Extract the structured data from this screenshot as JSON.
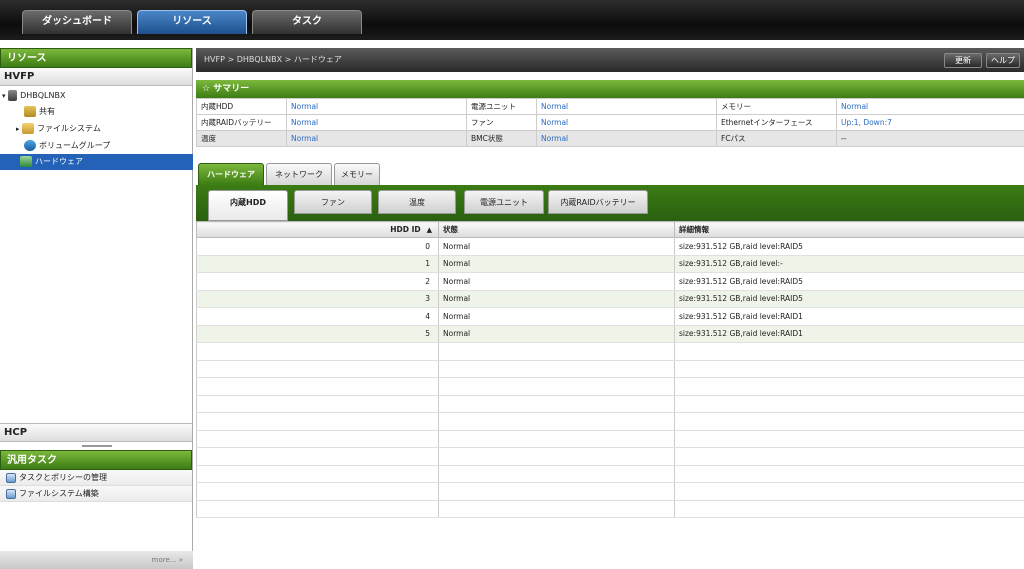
{
  "top_tabs": [
    "ダッシュボード",
    "リソース",
    "タスク"
  ],
  "left": {
    "panel_title": "リソース",
    "hvfp_label": "HVFP",
    "tree": {
      "server": "DHBQLNBX",
      "share": "共有",
      "filesystem": "ファイルシステム",
      "volume_group": "ボリュームグループ",
      "hardware": "ハードウェア"
    },
    "hcp_label": "HCP",
    "general_tasks_title": "汎用タスク",
    "tasks": [
      "タスクとポリシーの管理",
      "ファイルシステム構築"
    ],
    "footer": "more... »"
  },
  "main": {
    "breadcrumb": "HVFP > DHBQLNBX > ハードウェア",
    "update_button": "更新",
    "help_button": "ヘルプ",
    "summary_title": "☆ サマリー",
    "summary": [
      [
        "内蔵HDD",
        "Normal",
        "電源ユニット",
        "Normal",
        "メモリー",
        "Normal"
      ],
      [
        "内蔵RAIDバッテリー",
        "Normal",
        "ファン",
        "Normal",
        "Ethernetインターフェース",
        "Up:1, Down:7"
      ],
      [
        "温度",
        "Normal",
        "BMC状態",
        "Normal",
        "FCパス",
        "--"
      ]
    ],
    "hw_tabs": [
      "ハードウェア",
      "ネットワーク",
      "メモリー"
    ],
    "sub_tabs": [
      "内蔵HDD",
      "ファン",
      "温度",
      "電源ユニット",
      "内蔵RAIDバッテリー"
    ],
    "grid": {
      "columns": [
        "HDD ID",
        "状態",
        "詳細情報"
      ],
      "sort_indicator": "▲",
      "rows": [
        [
          "0",
          "Normal",
          "size:931.512 GB,raid level:RAID5"
        ],
        [
          "1",
          "Normal",
          "size:931.512 GB,raid level:-"
        ],
        [
          "2",
          "Normal",
          "size:931.512 GB,raid level:RAID5"
        ],
        [
          "3",
          "Normal",
          "size:931.512 GB,raid level:RAID5"
        ],
        [
          "4",
          "Normal",
          "size:931.512 GB,raid level:RAID1"
        ],
        [
          "5",
          "Normal",
          "size:931.512 GB,raid level:RAID1"
        ]
      ]
    }
  }
}
